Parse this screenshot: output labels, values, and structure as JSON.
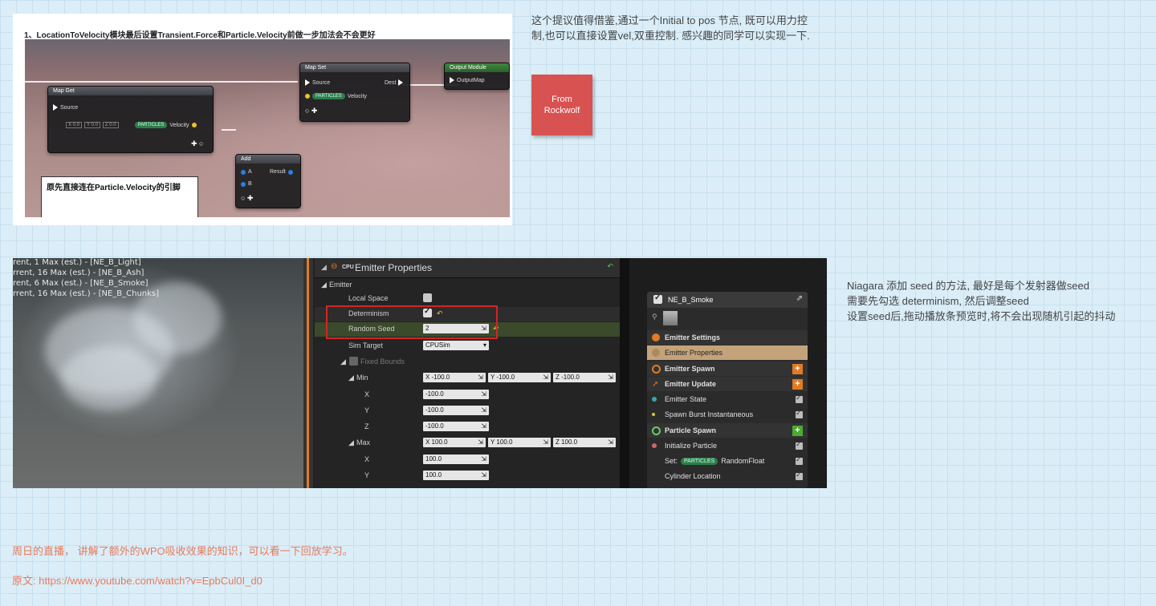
{
  "top_screenshot": {
    "heading": "1、LocationToVelocity模块最后设置Transient.Force和Particle.Velocity前做一步加法会不会更好",
    "node_map_get": {
      "title": "Map Get",
      "source": "Source",
      "x": "X 0.0",
      "y": "Y 0.0",
      "z": "Z 0.0",
      "badge": "PARTICLES",
      "velocity": "Velocity"
    },
    "node_add": {
      "title": "Add",
      "a": "A",
      "b": "B",
      "result": "Result"
    },
    "node_map_set": {
      "title": "Map Set",
      "source": "Source",
      "dest": "Dest",
      "badge": "PARTICLES",
      "velocity": "Velocity"
    },
    "node_output": {
      "title": "Output Module",
      "output_map": "OutputMap"
    },
    "note": "原先直接连在Particle.Velocity的引脚"
  },
  "right_text_1": "这个提议值得借鉴,通过一个Initial to pos 节点, 既可以用力控制,也可以直接设置vel,双重控制. 感兴趣的同学可以实现一下.",
  "sticker": {
    "line1": "From",
    "line2": "Rockwolf",
    "color": "#d75250"
  },
  "bottom_screenshot": {
    "viewport_stats": [
      "rent, 1 Max (est.) - [NE_B_Light]",
      "rrent, 16 Max (est.) - [NE_B_Ash]",
      "rent, 6 Max (est.) - [NE_B_Smoke]",
      "rrent, 16 Max (est.) - [NE_B_Chunks]"
    ],
    "props_title": "Emitter Properties",
    "props_cpu": "CPU",
    "section": "Emitter",
    "local_space": "Local Space",
    "determinism": "Determinism",
    "random_seed": "Random Seed",
    "random_seed_value": "2",
    "sim_target": "Sim Target",
    "sim_target_value": "CPUSim",
    "fixed_bounds": "Fixed Bounds",
    "min": "Min",
    "min_x": "X  -100.0",
    "min_y": "Y  -100.0",
    "min_z": "Z  -100.0",
    "x": "X",
    "y": "Y",
    "z": "Z",
    "x_val": "-100.0",
    "y_val": "-100.0",
    "z_val": "-100.0",
    "max": "Max",
    "max_x": "X  100.0",
    "max_y": "Y  100.0",
    "max_z": "Z  100.0",
    "max_x_val": "100.0",
    "max_y_val": "100.0",
    "stack": {
      "title": "NE_B_Smoke",
      "items": [
        {
          "label": "Emitter Settings",
          "bold": true
        },
        {
          "label": "Emitter Properties",
          "bold": false
        },
        {
          "label": "Emitter Spawn",
          "bold": true
        },
        {
          "label": "Emitter Update",
          "bold": true
        },
        {
          "label": "Emitter State",
          "bold": false
        },
        {
          "label": "Spawn Burst Instantaneous",
          "bold": false
        },
        {
          "label": "Particle Spawn",
          "bold": true
        },
        {
          "label": "Initialize Particle",
          "bold": false
        },
        {
          "label": "Set:",
          "badge": "PARTICLES",
          "suffix": "RandomFloat",
          "bold": false
        },
        {
          "label": "Cylinder Location",
          "bold": false
        }
      ]
    }
  },
  "right_text_2": {
    "line1": "Niagara 添加 seed 的方法, 最好是每个发射器做seed",
    "line2": "需要先勾选 determinism, 然后调整seed",
    "line3": "设置seed后,拖动播放条预览时,将不会出现随机引起的抖动"
  },
  "footer": {
    "line1": "周日的直播， 讲解了额外的WPO吸收效果的知识，可以看一下回放学习。",
    "line2": "原文: https://www.youtube.com/watch?v=EpbCul0I_d0"
  },
  "colors": {
    "accent_text": "#e8795a",
    "highlight_box": "#d42525",
    "panel_orange": "#e07b25"
  }
}
